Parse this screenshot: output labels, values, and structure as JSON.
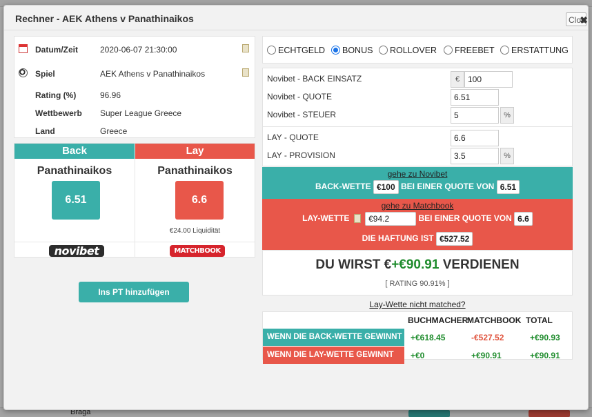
{
  "dialog": {
    "title": "Rechner - AEK Athens v Panathinaikos",
    "close_label": "Clos"
  },
  "info": {
    "rows": [
      {
        "label": "Datum/Zeit",
        "value": "2020-06-07 21:30:00"
      },
      {
        "label": "Spiel",
        "value": "AEK Athens v Panathinaikos"
      },
      {
        "label": "Rating (%)",
        "value": "96.96"
      },
      {
        "label": "Wettbewerb",
        "value": "Super League Greece"
      },
      {
        "label": "Land",
        "value": "Greece"
      }
    ]
  },
  "odds": {
    "back": {
      "header": "Back",
      "team": "Panathinaikos",
      "odds": "6.51",
      "bookmaker": "novibet"
    },
    "lay": {
      "header": "Lay",
      "team": "Panathinaikos",
      "odds": "6.6",
      "liquidity": "€24.00 Liquidität",
      "exchange": "MATCHBOOK"
    }
  },
  "add_pt_button": "Ins PT hinzufügen",
  "bet_types": [
    {
      "label": "ECHTGELD",
      "selected": false
    },
    {
      "label": "BONUS",
      "selected": true
    },
    {
      "label": "ROLLOVER",
      "selected": false
    },
    {
      "label": "FREEBET",
      "selected": false
    },
    {
      "label": "ERSTATTUNG",
      "selected": false
    }
  ],
  "calc": {
    "back_stake_label": "Novibet - BACK EINSATZ",
    "currency_symbol": "€",
    "back_stake_value": "100",
    "back_odds_label": "Novibet - QUOTE",
    "back_odds_value": "6.51",
    "back_tax_label": "Novibet - STEUER",
    "back_tax_value": "5",
    "percent_symbol": "%",
    "lay_odds_label": "LAY - QUOTE",
    "lay_odds_value": "6.6",
    "lay_commission_label": "LAY - PROVISION",
    "lay_commission_value": "3.5"
  },
  "instructions": {
    "goto_back": "gehe zu Novibet",
    "back_bet_label": "BACK-WETTE",
    "back_bet_amount": "€100",
    "at_odds_label": "BEI EINER QUOTE VON",
    "back_bet_odds": "6.51",
    "goto_lay": "gehe zu Matchbook",
    "lay_bet_label": "LAY-WETTE",
    "lay_bet_amount": "€94.2",
    "lay_at_odds_label": "BEI EINER QUOTE VON",
    "lay_bet_odds": "6.6",
    "liability_label": "DIE HAFTUNG IST",
    "liability_amount": "€527.52"
  },
  "result": {
    "prefix": "DU WIRST €",
    "amount": "+€90.91",
    "suffix": "VERDIENEN",
    "rating": "[ RATING 90.91% ]"
  },
  "lay_not_matched": "Lay-Wette nicht matched?",
  "summary": {
    "headers": [
      "BUCHMACHER",
      "MATCHBOOK",
      "TOTAL"
    ],
    "rows": [
      {
        "label": "WENN DIE BACK-WETTE GEWINNT",
        "bookmaker": "+€618.45",
        "exchange": "-€527.52",
        "total": "+€90.93"
      },
      {
        "label": "WENN DIE LAY-WETTE GEWINNT",
        "bookmaker": "+€0",
        "exchange": "+€90.91",
        "total": "+€90.91"
      }
    ]
  },
  "background": {
    "visible_text": "Braga"
  },
  "colors": {
    "teal": "#3aafa9",
    "red": "#e8574a",
    "green": "#1f8c2d"
  }
}
